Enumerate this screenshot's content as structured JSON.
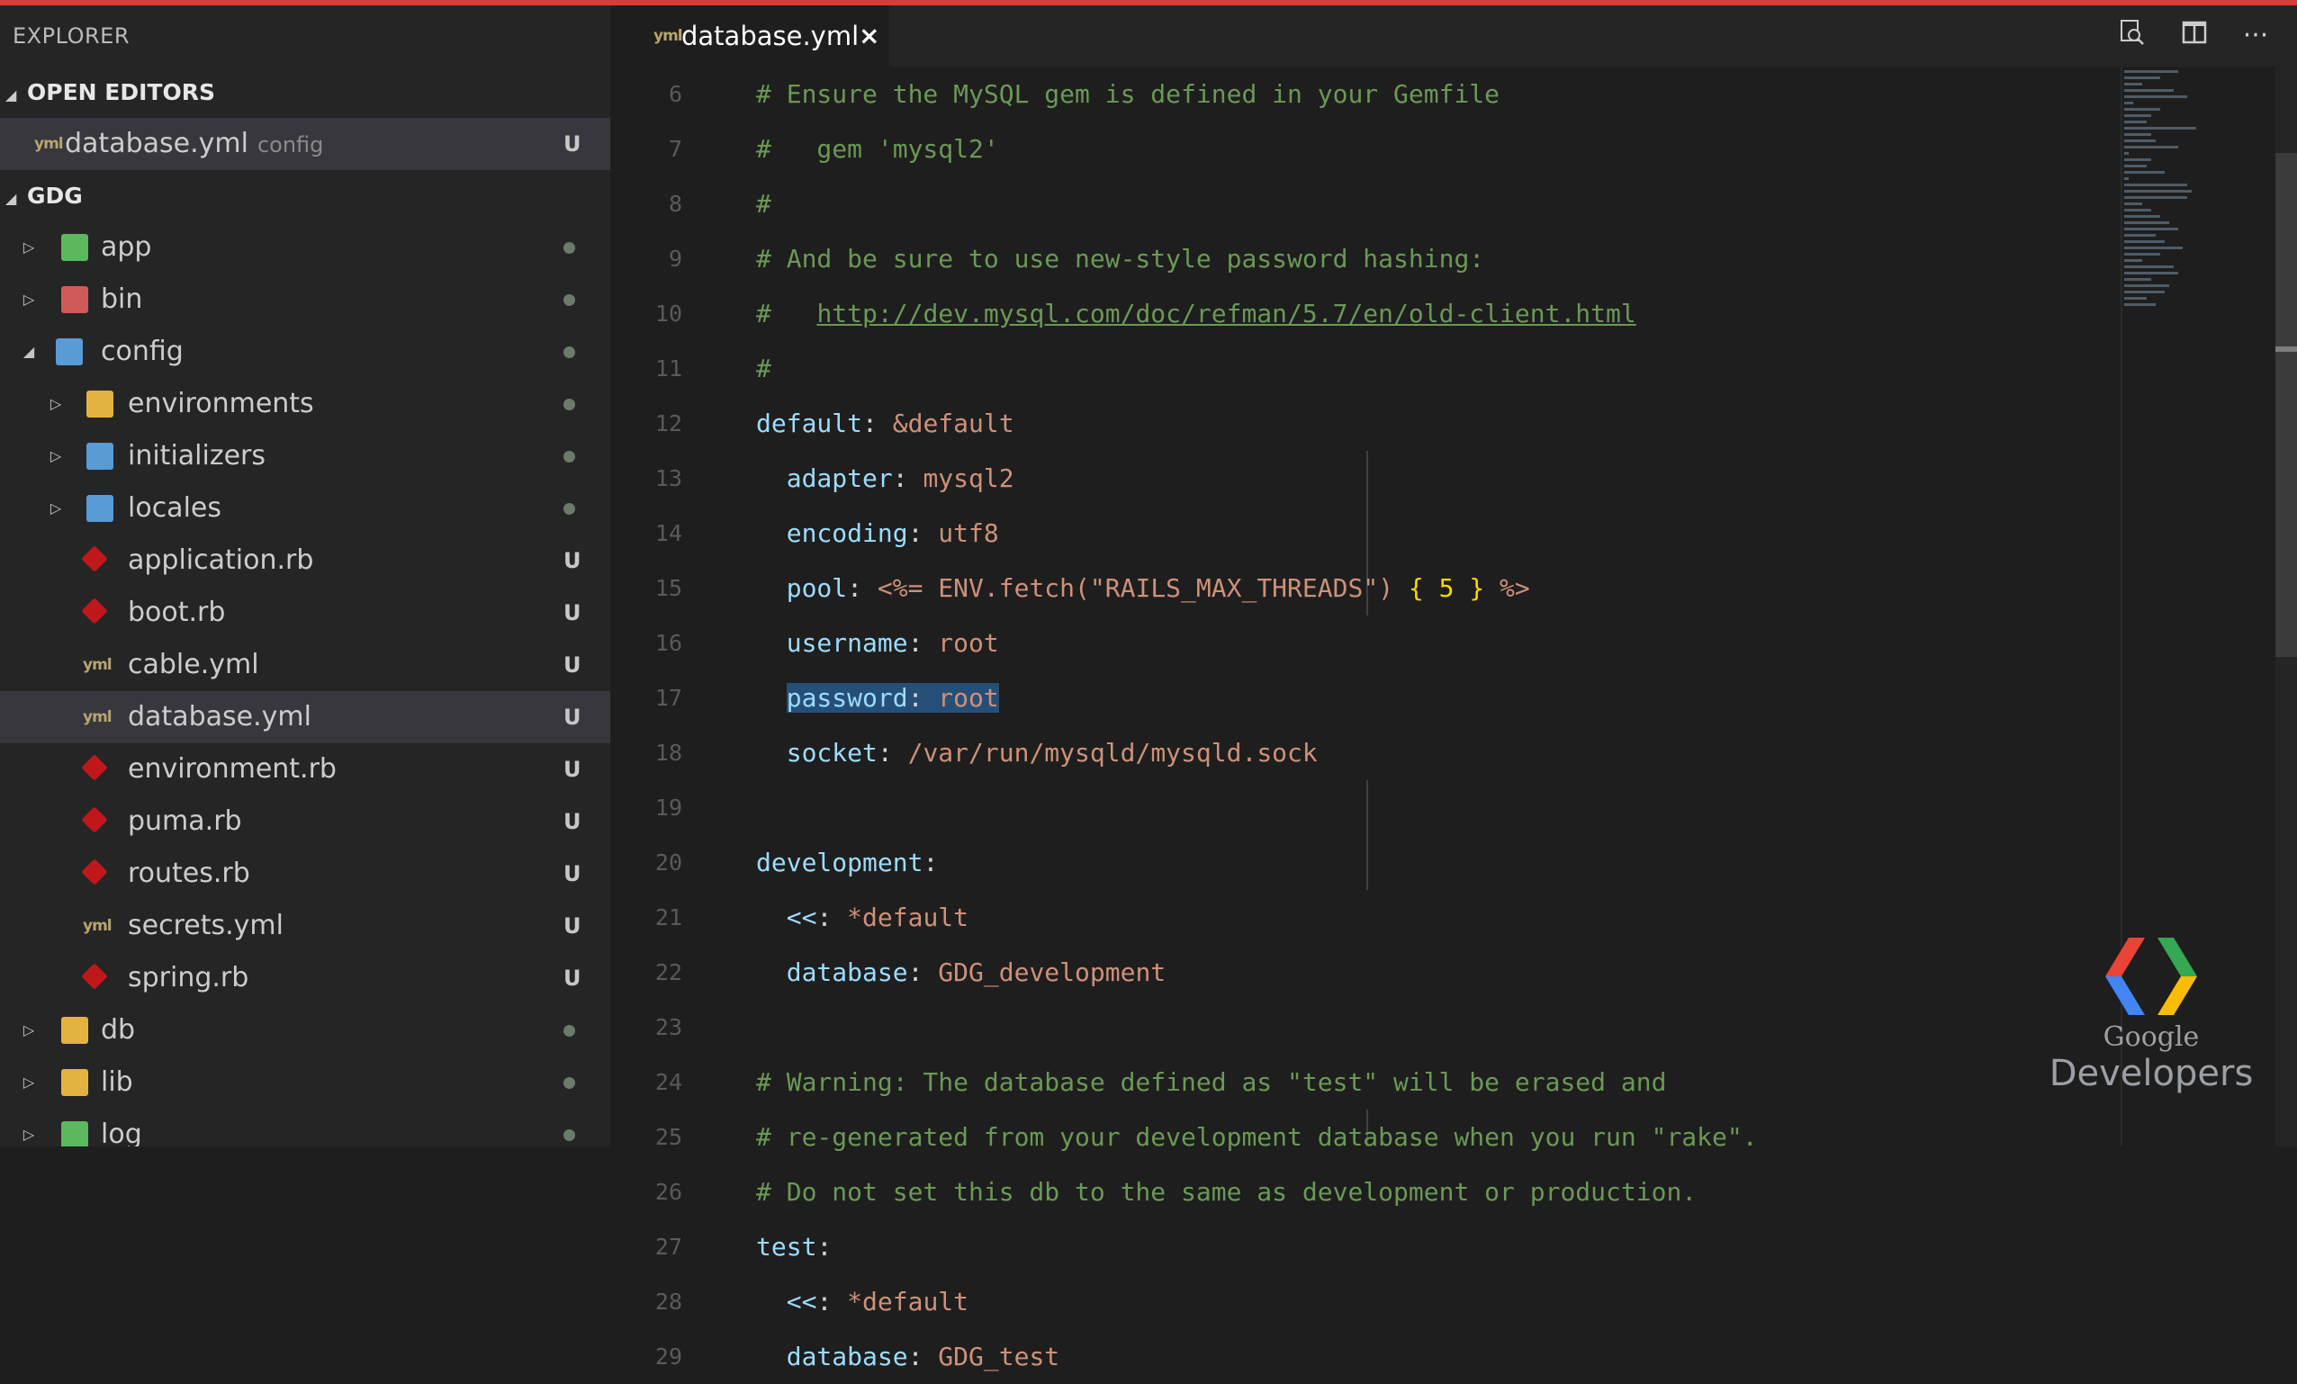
{
  "explorer": {
    "title": "EXPLORER",
    "open_editors_label": "OPEN EDITORS",
    "open_editors": [
      {
        "name": "database.yml",
        "desc": "config",
        "badge": "U"
      }
    ],
    "project_label": "GDG",
    "tree": [
      {
        "name": "app",
        "status": "dot"
      },
      {
        "name": "bin",
        "status": "dot"
      },
      {
        "name": "config",
        "status": "dot"
      },
      {
        "name": "environments",
        "status": "dot"
      },
      {
        "name": "initializers",
        "status": "dot"
      },
      {
        "name": "locales",
        "status": "dot"
      },
      {
        "name": "application.rb",
        "badge": "U"
      },
      {
        "name": "boot.rb",
        "badge": "U"
      },
      {
        "name": "cable.yml",
        "badge": "U"
      },
      {
        "name": "database.yml",
        "badge": "U"
      },
      {
        "name": "environment.rb",
        "badge": "U"
      },
      {
        "name": "puma.rb",
        "badge": "U"
      },
      {
        "name": "routes.rb",
        "badge": "U"
      },
      {
        "name": "secrets.yml",
        "badge": "U"
      },
      {
        "name": "spring.rb",
        "badge": "U"
      },
      {
        "name": "db",
        "status": "dot"
      },
      {
        "name": "lib",
        "status": "dot"
      },
      {
        "name": "log",
        "status": "dot"
      }
    ]
  },
  "tab": {
    "name": "database.yml",
    "close": "×",
    "file_icon": "yml"
  },
  "toolbar": {
    "more": "···"
  },
  "editor": {
    "line_numbers": [
      "6",
      "7",
      "8",
      "9",
      "10",
      "11",
      "12",
      "13",
      "14",
      "15",
      "16",
      "17",
      "18",
      "19",
      "20",
      "21",
      "22",
      "23",
      "24",
      "25",
      "26",
      "27",
      "28",
      "29"
    ],
    "lines": {
      "l6": "# Ensure the MySQL gem is defined in your Gemfile",
      "l7": "#   gem 'mysql2'",
      "l8": "#",
      "l9": "# And be sure to use new-style password hashing:",
      "l10_hash": "#   ",
      "l10_url": "http://dev.mysql.com/doc/refman/5.7/en/old-client.html",
      "l11": "#",
      "l12_key": "default",
      "l12_colon": ": ",
      "l12_anchor": "&default",
      "l13_key": "adapter",
      "l13_val": "mysql2",
      "l14_key": "encoding",
      "l14_val": "utf8",
      "l15_key": "pool",
      "l15_a": "<%= ENV.fetch(",
      "l15_str": "\"RAILS_MAX_THREADS\"",
      "l15_b": ") ",
      "l15_brace_open": "{",
      "l15_num": " 5 ",
      "l15_brace_close": "}",
      "l15_end": " %>",
      "l16_key": "username",
      "l16_val": "root",
      "l17_key": "password",
      "l17_val": "root",
      "l18_key": "socket",
      "l18_val": "/var/run/mysqld/mysqld.sock",
      "l20_key": "development",
      "l21_key": "<<",
      "l21_val": "*default",
      "l22_key": "database",
      "l22_val": "GDG_development",
      "l24": "# Warning: The database defined as \"test\" will be erased and",
      "l25": "# re-generated from your development database when you run \"rake\".",
      "l26": "# Do not set this db to the same as development or production.",
      "l27_key": "test",
      "l28_key": "<<",
      "l28_val": "*default",
      "l29_key": "database",
      "l29_val": "GDG_test",
      "colon": ": ",
      "colon_end": ":"
    }
  },
  "watermark": {
    "line1": "Google",
    "line2": "Developers"
  },
  "colors": {
    "accent_bar": "#d83b3b",
    "selection": "#264f78",
    "comment": "#6a9955",
    "key": "#9cdcfe",
    "string": "#ce9178"
  }
}
